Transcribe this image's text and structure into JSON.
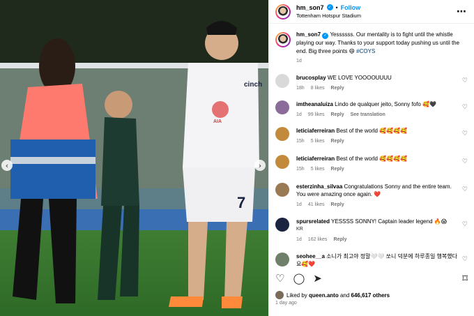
{
  "post": {
    "username": "hm_son7",
    "follow_label": "Follow",
    "location": "Tottenham Hotspur Stadium",
    "caption_text": "Yessssss. Our mentality is to fight until the whistle playing our way. Thanks to your support today pushing us until the end. Big three points 😄 ",
    "hashtag": "#COYS",
    "caption_time": "1d",
    "jersey_text": "cinch",
    "shorts_number": "7",
    "sponsor_text": "AIA"
  },
  "comments": [
    {
      "username": "brucosplay",
      "text": "WE LOVE YOOOOUUUU",
      "time": "18h",
      "likes": "8 likes",
      "reply": "Reply",
      "extra": "",
      "avatar_color": "#d9d9d9"
    },
    {
      "username": "imtheanaluiza",
      "text": "Lindo de qualquer jeito, Sonny fofo 🥰🖤",
      "time": "1d",
      "likes": "99 likes",
      "reply": "Reply",
      "extra": "See translation",
      "avatar_color": "#8a6b9a"
    },
    {
      "username": "leticiaferreiran",
      "text": "Best of the world 🥰🥰🥰🥰",
      "time": "15h",
      "likes": "5 likes",
      "reply": "Reply",
      "extra": "",
      "avatar_color": "#c28a3a"
    },
    {
      "username": "leticiaferreiran",
      "text": "Best of the world 🥰🥰🥰🥰",
      "time": "15h",
      "likes": "5 likes",
      "reply": "Reply",
      "extra": "",
      "avatar_color": "#c28a3a"
    },
    {
      "username": "esterzinha_silvaa",
      "text": "Congratulations Sonny and the entire team. You were amazing once again. ❤️",
      "time": "1d",
      "likes": "41 likes",
      "reply": "Reply",
      "extra": "",
      "avatar_color": "#9a7a52"
    },
    {
      "username": "spursrelated",
      "text": "YESSSS SONNY! Captain leader legend 🔥😱",
      "sub": "KR",
      "time": "1d",
      "likes": "162 likes",
      "reply": "Reply",
      "extra": "",
      "avatar_color": "#1a2340"
    },
    {
      "username": "seohee__a",
      "text": "소니가 최고야 정말🤍🤍 쏘니 덕분에 하루종일 행복했다요🥰❤️",
      "time": "",
      "likes": "",
      "reply": "",
      "extra": "",
      "avatar_color": "#6f7f6a"
    }
  ],
  "footer": {
    "liked_by_prefix": "Liked by ",
    "liked_by_user": "queen.anto",
    "liked_by_mid": " and ",
    "liked_count": "646,617 others",
    "posted": "1 day ago"
  },
  "icons": {
    "like": "heart-icon",
    "comment": "comment-icon",
    "share": "share-icon",
    "save": "bookmark-icon",
    "more": "more-icon",
    "prev": "chevron-left-icon",
    "next": "chevron-right-icon"
  },
  "colors": {
    "accent": "#0095f6",
    "hashtag": "#00376b",
    "meta": "#737373"
  }
}
